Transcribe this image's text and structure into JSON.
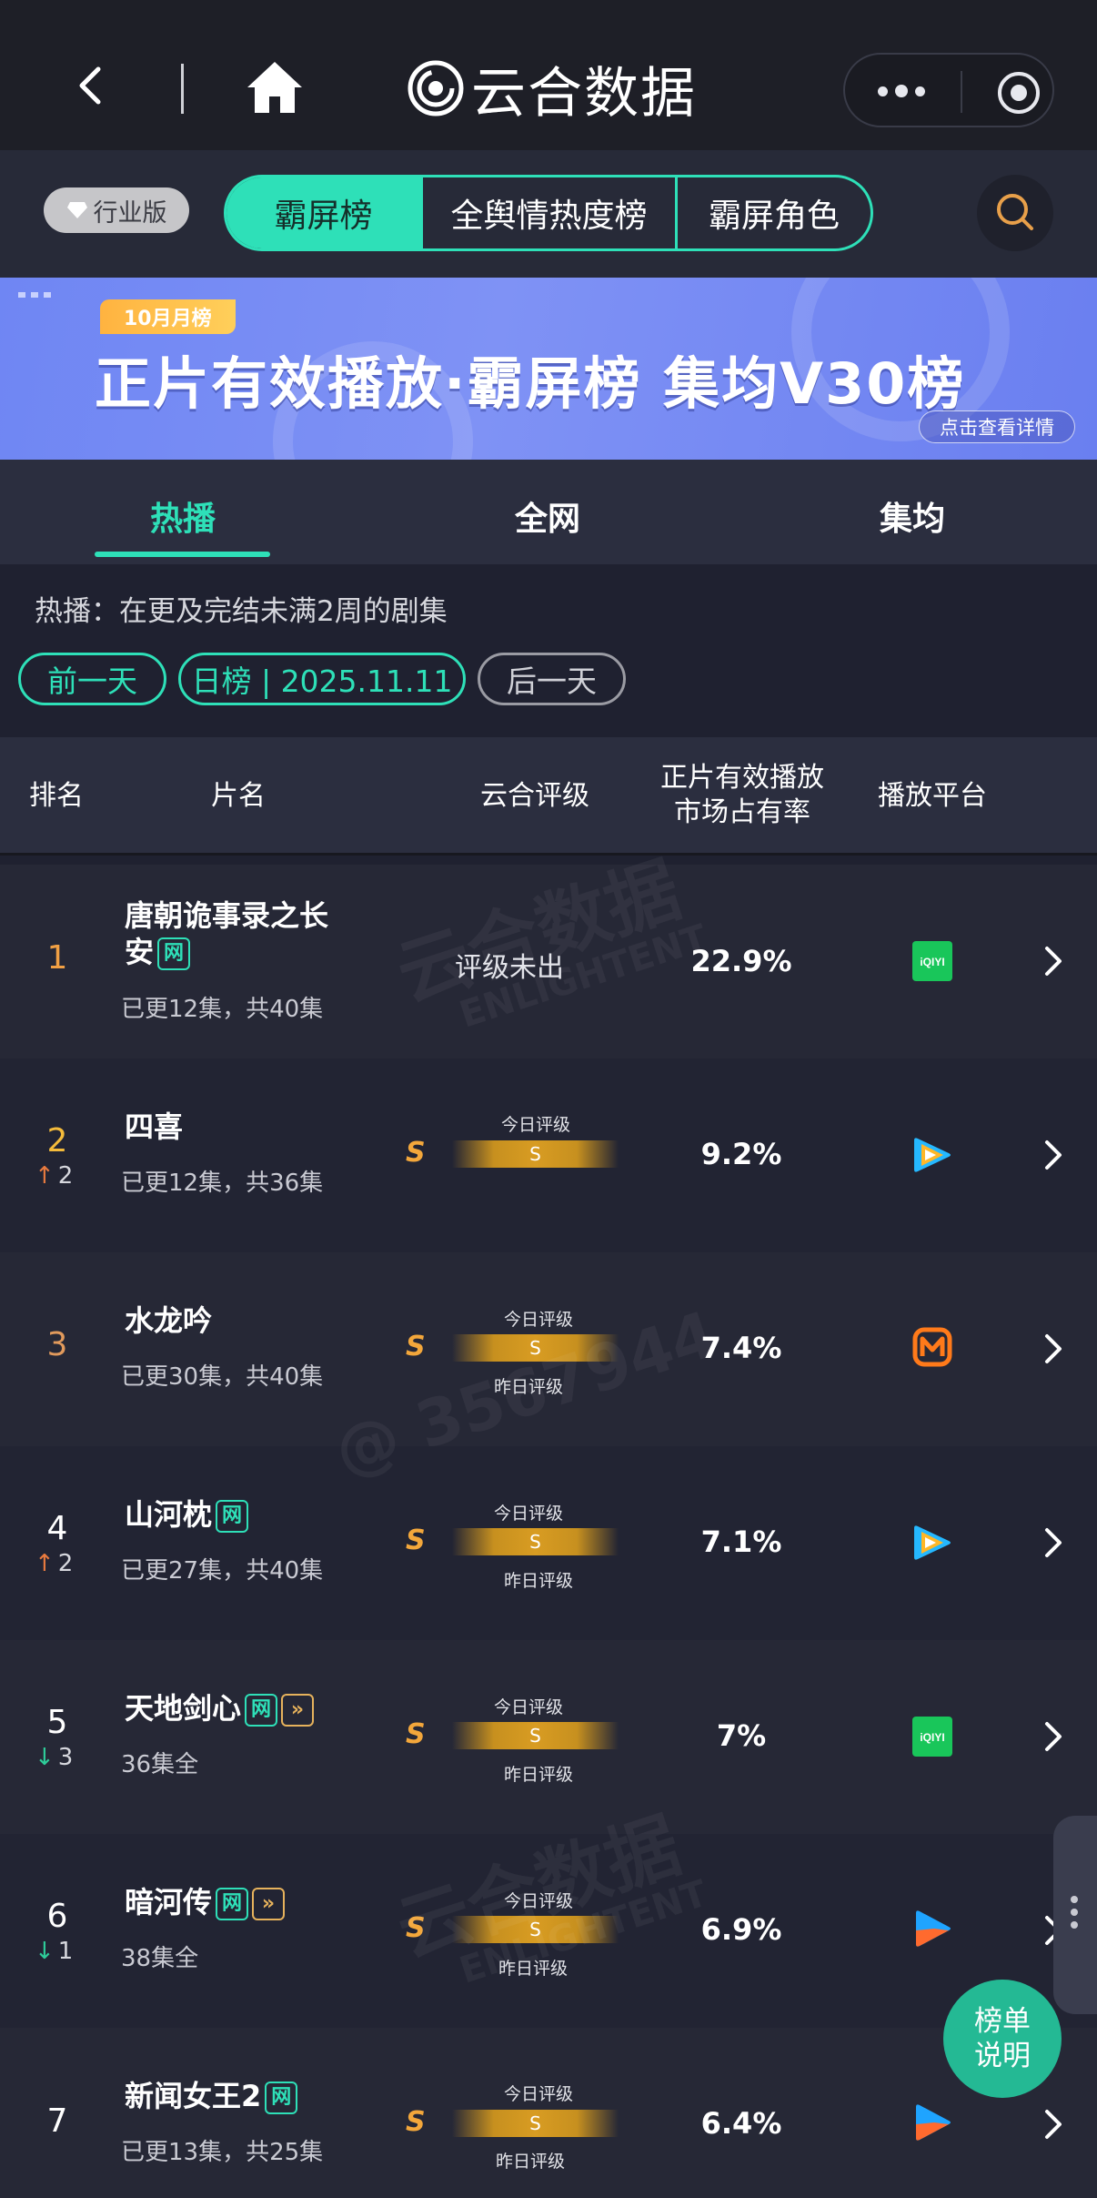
{
  "nav": {
    "app_name": "云合数据",
    "back_icon": "chevron-left-icon",
    "home_icon": "home-icon",
    "more_icon": "more-dots-icon",
    "target_icon": "target-icon"
  },
  "header": {
    "industry_badge": "行业版",
    "segments": [
      {
        "label": "霸屏榜",
        "active": true
      },
      {
        "label": "全舆情热度榜",
        "active": false
      },
      {
        "label": "霸屏角色",
        "active": false
      }
    ],
    "search_icon": "search-icon"
  },
  "banner": {
    "month_tag": "10月月榜",
    "title": "正片有效播放·霸屏榜 集均V30榜",
    "detail_button": "点击查看详情"
  },
  "tabs": [
    {
      "label": "热播",
      "active": true
    },
    {
      "label": "全网",
      "active": false
    },
    {
      "label": "集均",
      "active": false
    }
  ],
  "hint": "热播：在更及完结未满2周的剧集",
  "date_controls": {
    "prev": "前一天",
    "current": "日榜 | 2025.11.11",
    "next": "后一天"
  },
  "table": {
    "headers": {
      "rank": "排名",
      "title": "片名",
      "rating": "云合评级",
      "share_line1": "正片有效播放",
      "share_line2": "市场占有率",
      "platform": "播放平台"
    },
    "today_label": "今日评级",
    "yesterday_label": "昨日评级",
    "rows": [
      {
        "rank": "1",
        "title_line1": "唐朝诡事录之长",
        "title_line2": "安",
        "tags": [
          "网"
        ],
        "episodes": "已更12集，共40集",
        "rating": "评级未出",
        "share": "22.9%",
        "platform": "iqiyi",
        "trend": ""
      },
      {
        "rank": "2",
        "title_line1": "四喜",
        "tags": [],
        "episodes": "已更12集，共36集",
        "rating": "S",
        "rating_mark": "S",
        "share": "9.2%",
        "platform": "tencent-video",
        "trend": "up",
        "trend_value": "2"
      },
      {
        "rank": "3",
        "title_line1": "水龙吟",
        "tags": [],
        "episodes": "已更30集，共40集",
        "rating": "S",
        "rating_mark": "S",
        "share": "7.4%",
        "platform": "mango-tv",
        "trend": ""
      },
      {
        "rank": "4",
        "title_line1": "山河枕",
        "tags": [
          "网"
        ],
        "episodes": "已更27集，共40集",
        "rating": "S",
        "rating_mark": "S",
        "share": "7.1%",
        "platform": "tencent-video",
        "trend": "up",
        "trend_value": "2"
      },
      {
        "rank": "5",
        "title_line1": "天地剑心",
        "tags": [
          "网",
          "forward"
        ],
        "episodes": "36集全",
        "rating": "S",
        "rating_mark": "S",
        "share": "7%",
        "platform": "iqiyi",
        "trend": "down",
        "trend_value": "3"
      },
      {
        "rank": "6",
        "title_line1": "暗河传",
        "tags": [
          "网",
          "forward"
        ],
        "episodes": "38集全",
        "rating": "S",
        "rating_mark": "S",
        "share": "6.9%",
        "platform": "youku",
        "trend": "down",
        "trend_value": "1"
      },
      {
        "rank": "7",
        "title_line1": "新闻女王2",
        "tags": [
          "网"
        ],
        "episodes": "已更13集，共25集",
        "rating": "S",
        "rating_mark": "S",
        "share": "6.4%",
        "platform": "youku",
        "trend": ""
      }
    ]
  },
  "fab": {
    "line1": "榜单",
    "line2": "说明"
  },
  "watermark": {
    "brand": "云合数据",
    "brand_en": "ENLIGHTENT",
    "user": "@ 3567944"
  },
  "colors": {
    "accent": "#2ee0b8",
    "rating": "#f3a73b",
    "up": "#e87a3f",
    "down": "#2ecc99"
  }
}
